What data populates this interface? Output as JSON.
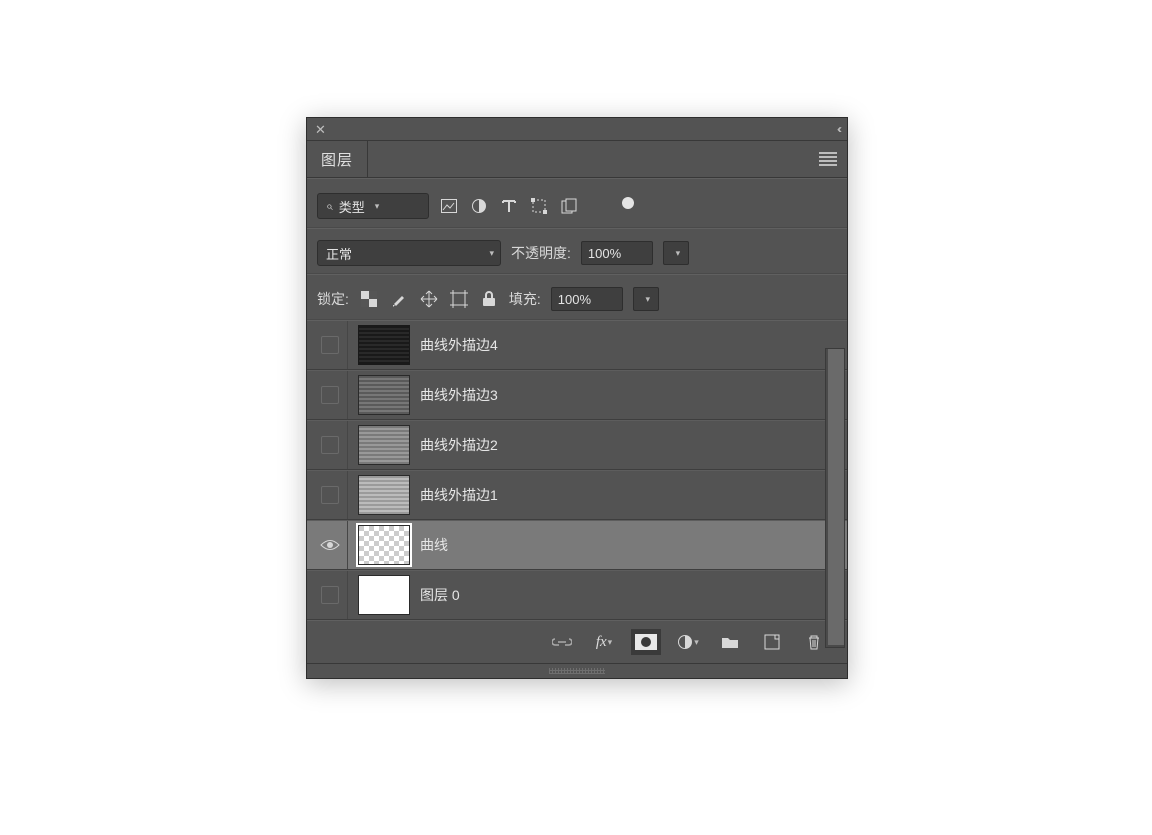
{
  "titlebar": {
    "close": "✕",
    "collapse": "‹‹"
  },
  "tabs": {
    "layers": "图层"
  },
  "filter": {
    "kind_label": "类型"
  },
  "blend": {
    "mode": "正常",
    "opacity_label": "不透明度:",
    "opacity_value": "100%"
  },
  "lock": {
    "label": "锁定:",
    "fill_label": "填充:",
    "fill_value": "100%"
  },
  "layers": [
    {
      "name": "曲线外描边4",
      "thumb": "dark",
      "visible": false,
      "selected": false
    },
    {
      "name": "曲线外描边3",
      "thumb": "gray1",
      "visible": false,
      "selected": false
    },
    {
      "name": "曲线外描边2",
      "thumb": "gray2",
      "visible": false,
      "selected": false
    },
    {
      "name": "曲线外描边1",
      "thumb": "gray3",
      "visible": false,
      "selected": false
    },
    {
      "name": "曲线",
      "thumb": "checker",
      "visible": true,
      "selected": true
    },
    {
      "name": "图层 0",
      "thumb": "white",
      "visible": false,
      "selected": false
    }
  ],
  "footer_icons": {
    "link": "link",
    "fx": "fx",
    "mask": "mask",
    "adj": "adj",
    "group": "group",
    "new": "new",
    "trash": "trash"
  }
}
